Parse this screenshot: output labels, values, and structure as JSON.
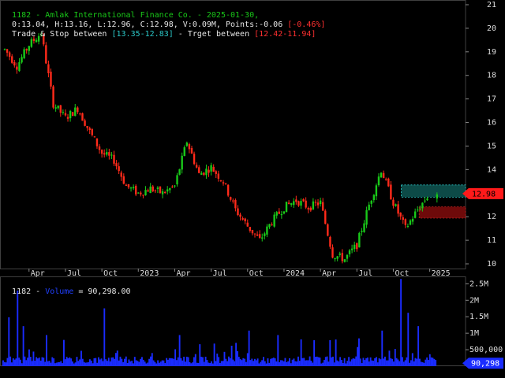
{
  "header": {
    "line1_title": "1182 - Amlak International Finance Co. - 2025-01-30,",
    "line2_ohlc": "0:13.04, H:13.16, L:12.96, C:12.98, V:0.09M, Points:-0.06 ",
    "line2_change": "[-0.46%]",
    "line3_trade_prefix": "Trade & Stop between ",
    "line3_trade_range": "[13.35-12.83]",
    "line3_target_prefix": " - Trget between ",
    "line3_target_range": "[12.42-11.94]"
  },
  "volume_panel": {
    "symbol": "1182 - ",
    "indicator": "Volume",
    "value_text": " = 90,298.00",
    "last_badge": "90,298"
  },
  "price_badge": "12.98",
  "colors": {
    "up": "#19c919",
    "down": "#ff2a1a",
    "volume": "#1a2cff",
    "trade_zone": "#0d4a47",
    "target_zone": "#6e0a0a",
    "grid": "#404040"
  },
  "chart_data": [
    {
      "type": "candlestick",
      "y_ticks": [
        "10",
        "11",
        "12",
        "13",
        "14",
        "15",
        "16",
        "17",
        "18",
        "19",
        "20",
        "21"
      ],
      "ylim": [
        9.8,
        21.2
      ],
      "x_ticks": [
        "Apr",
        "Jul",
        "Oct",
        "2023",
        "Apr",
        "Jul",
        "Oct",
        "2024",
        "Apr",
        "Jul",
        "Oct",
        "2025"
      ],
      "x_range": [
        "2022-02",
        "2025-02"
      ],
      "series_path_close": [
        [
          "2022-02",
          19.1
        ],
        [
          "2022-03",
          18.4
        ],
        [
          "2022-04",
          19.3
        ],
        [
          "2022-05",
          19.8
        ],
        [
          "2022-06",
          16.8
        ],
        [
          "2022-07",
          16.2
        ],
        [
          "2022-08",
          16.6
        ],
        [
          "2022-09",
          15.6
        ],
        [
          "2022-10",
          14.7
        ],
        [
          "2022-11",
          14.4
        ],
        [
          "2022-12",
          13.3
        ],
        [
          "2023-01",
          13.0
        ],
        [
          "2023-02",
          13.2
        ],
        [
          "2023-03",
          13.0
        ],
        [
          "2023-04",
          13.3
        ],
        [
          "2023-05",
          15.2
        ],
        [
          "2023-06",
          13.8
        ],
        [
          "2023-07",
          14.1
        ],
        [
          "2023-08",
          13.5
        ],
        [
          "2023-09",
          12.3
        ],
        [
          "2023-10",
          11.6
        ],
        [
          "2023-11",
          11.0
        ],
        [
          "2023-12",
          11.8
        ],
        [
          "2024-01",
          12.4
        ],
        [
          "2024-02",
          12.7
        ],
        [
          "2024-03",
          12.4
        ],
        [
          "2024-04",
          12.6
        ],
        [
          "2024-05",
          10.4
        ],
        [
          "2024-06",
          10.2
        ],
        [
          "2024-07",
          10.8
        ],
        [
          "2024-08",
          12.5
        ],
        [
          "2024-09",
          14.0
        ],
        [
          "2024-10",
          12.6
        ],
        [
          "2024-11",
          11.5
        ],
        [
          "2024-12",
          12.3
        ],
        [
          "2025-01",
          13.0
        ]
      ],
      "last_close": 12.98,
      "trade_zone": [
        12.83,
        13.35
      ],
      "target_zone": [
        11.94,
        12.42
      ]
    },
    {
      "type": "bar",
      "name": "Volume",
      "y_ticks": [
        "500,000",
        "1M",
        "1.5M",
        "2M",
        "2.5M"
      ],
      "ylim": [
        0,
        2700000
      ],
      "last_value": 90298
    }
  ]
}
